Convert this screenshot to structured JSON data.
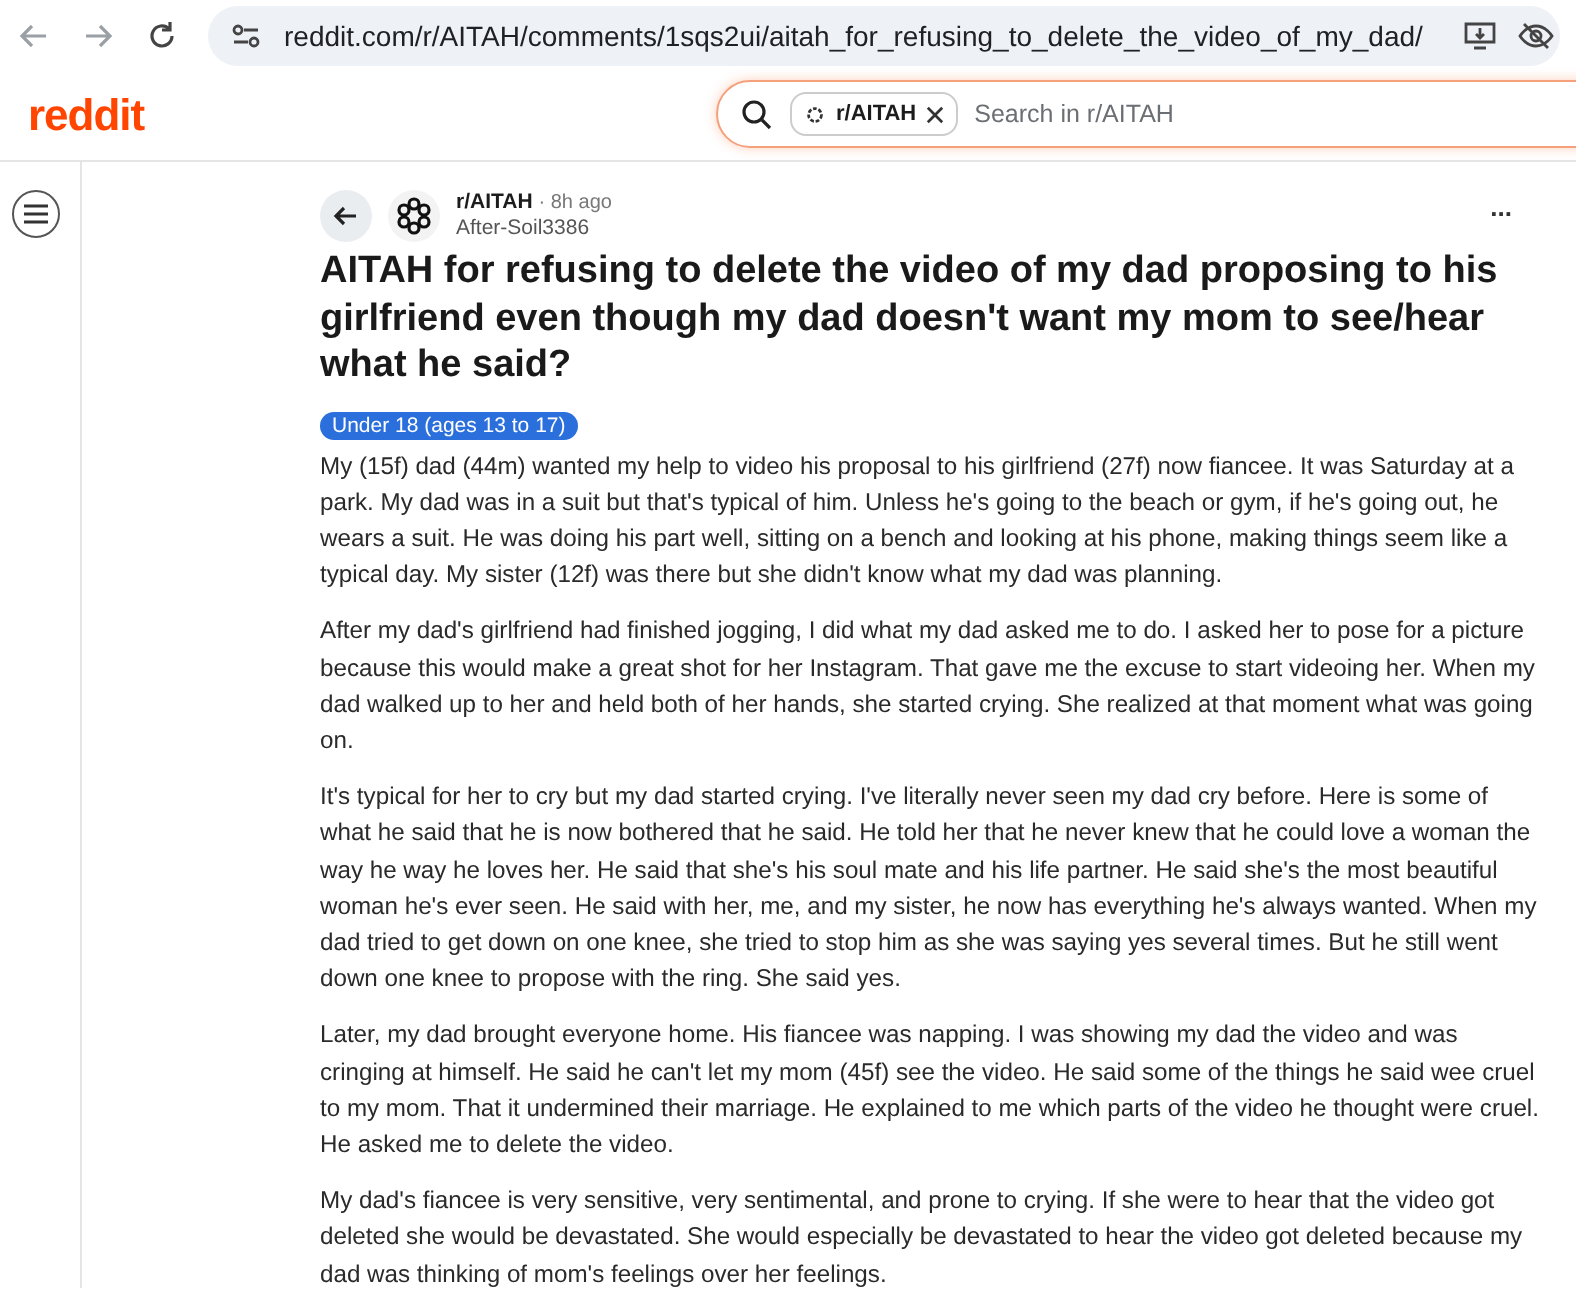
{
  "browser": {
    "url": "reddit.com/r/AITAH/comments/1sqs2ui/aitah_for_refusing_to_delete_the_video_of_my_dad/"
  },
  "header": {
    "logo": "reddit",
    "search_chip": "r/AITAH",
    "search_placeholder": "Search in r/AITAH"
  },
  "post": {
    "subreddit": "r/AITAH",
    "time": "8h ago",
    "author": "After-Soil3386",
    "more": "...",
    "title": "AITAH for refusing to delete the video of my dad proposing to his girlfriend even though my dad doesn't want my mom to see/hear what he said?",
    "flair": "Under 18 (ages 13 to 17)",
    "separator": "·",
    "paragraphs": [
      "My (15f) dad (44m) wanted my help to video his proposal to his girlfriend (27f) now fiancee. It was Saturday at a park. My dad was in a suit but that's typical of him. Unless he's going to the beach or gym, if he's going out, he wears a suit. He was doing his part well, sitting on a bench and looking at his phone, making things seem like a typical day. My sister (12f) was there but she didn't know what my dad was planning.",
      "After my dad's girlfriend had finished jogging, I did what my dad asked me to do. I asked her to pose for a picture because this would make a great shot for her Instagram. That gave me the excuse to start videoing her. When my dad walked up to her and held both of her hands, she started crying. She realized at that moment what was going on.",
      "It's typical for her to cry but my dad started crying. I've literally never seen my dad cry before. Here is some of what he said that he is now bothered that he said. He told her that he never knew that he could love a woman the way he way he loves her. He said that she's his soul mate and his life partner. He said she's the most beautiful woman he's ever seen. He said with her, me, and my sister, he now has everything he's always wanted. When my dad tried to get down on one knee, she tried to stop him as she was saying yes several times. But he still went down one knee to propose with the ring. She said yes.",
      "Later, my dad brought everyone home. His fiancee was napping. I was showing my dad the video and was cringing at himself. He said he can't let my mom (45f) see the video. He said some of the things he said wee cruel to my mom. That it undermined their marriage. He explained to me which parts of the video he thought were cruel. He asked me to delete the video.",
      "My dad's fiancee is very sensitive, very sentimental, and prone to crying. If she were to hear that the video got deleted she would be devastated. She would especially be devastated to hear the video got deleted because my dad was thinking of mom's feelings over her feelings."
    ]
  }
}
